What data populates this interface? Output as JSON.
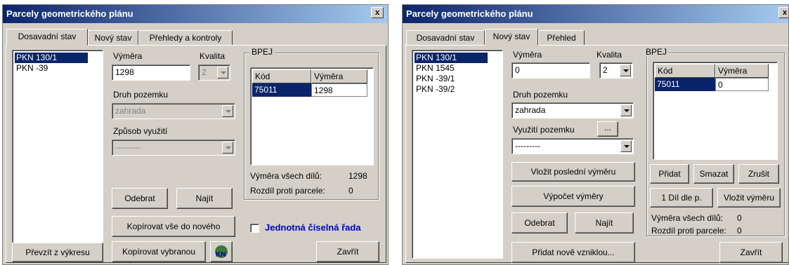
{
  "left": {
    "title": "Parcely geometrického plánu",
    "close_label": "x",
    "tabs": [
      "Dosavadní stav",
      "Nový stav",
      "Přehledy a kontroly"
    ],
    "parcels": [
      "PKN 130/1",
      "PKN -39"
    ],
    "vymera_label": "Výměra",
    "vymera_value": "1298",
    "kvalita_label": "Kvalita",
    "kvalita_value": "2",
    "druh_label": "Druh pozemku",
    "druh_value": "zahrada",
    "zpusob_label": "Způsob využití",
    "zpusob_value": "---------",
    "bpej_title": "BPEJ",
    "grid_headers": [
      "Kód",
      "Výměra"
    ],
    "grid_row": {
      "kod": "75011",
      "vymera": "1298"
    },
    "vymera_vsech_label": "Výměra všech dílů:",
    "vymera_vsech_value": "1298",
    "rozdil_label": "Rozdíl proti parcele:",
    "rozdil_value": "0",
    "btn_odebrat": "Odebrat",
    "btn_najit": "Najít",
    "btn_kopirovat_vse": "Kopírovat vše do nového",
    "btn_kopirovat_vybranou": "Kopírovat vybranou",
    "checkbox_label": "Jednotná číselná řada",
    "btn_prevzit": "Převzít z výkresu",
    "btn_zavrit": "Zavřít",
    "kn_icon_text": "KN"
  },
  "right": {
    "title": "Parcely geometrického plánu",
    "close_label": "x",
    "tabs": [
      "Dosavadní stav",
      "Nový stav",
      "Přehled"
    ],
    "parcels": [
      "PKN 130/1",
      "PKN 1545",
      "PKN -39/1",
      "PKN -39/2"
    ],
    "vymera_label": "Výměra",
    "vymera_value": "0",
    "kvalita_label": "Kvalita",
    "kvalita_value": "2",
    "druh_label": "Druh pozemku",
    "druh_value": "zahrada",
    "vyuziti_label": "Využití pozemku",
    "vyuziti_btn": "...",
    "vyuziti_value": "---------",
    "btn_vlozit_posledni": "Vložit poslední výměru",
    "btn_vypocet": "Výpočet výměry",
    "btn_odebrat": "Odebrat",
    "btn_najit": "Najít",
    "btn_pridat_nove": "Přidat nově vzniklou...",
    "bpej_title": "BPEJ",
    "grid_headers": [
      "Kód",
      "Výměra"
    ],
    "grid_row": {
      "kod": "75011",
      "vymera": "0"
    },
    "btn_pridat": "Přidat",
    "btn_smazat": "Smazat",
    "btn_zrusit": "Zrušit",
    "btn_dil": "1 Díl dle p.",
    "btn_vlozit_vymeru": "Vložit výměru",
    "vymera_vsech_label": "Výměra všech dílů:",
    "vymera_vsech_value": "0",
    "rozdil_label": "Rozdíl proti parcele:",
    "rozdil_value": "0",
    "btn_zavrit": "Zavřít"
  }
}
